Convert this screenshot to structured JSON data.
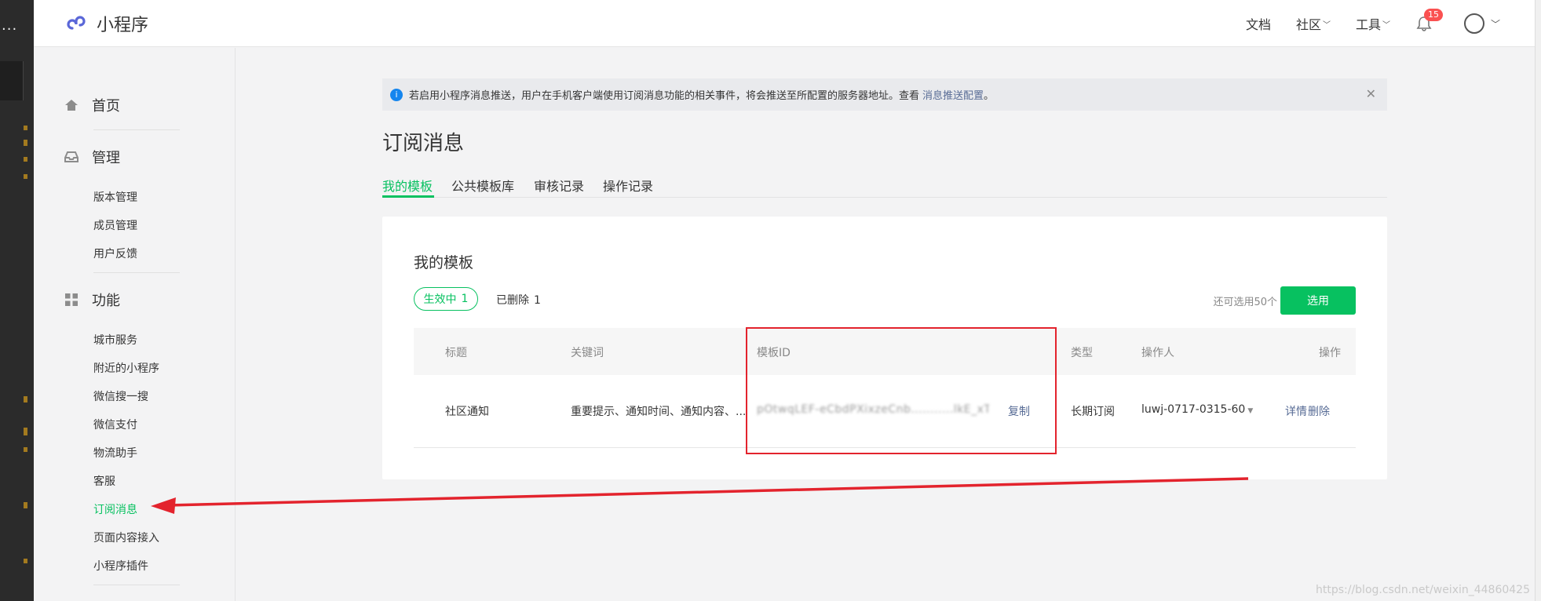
{
  "brand": {
    "name": "小程序"
  },
  "topnav": {
    "docs": "文档",
    "community": "社区",
    "tools": "工具",
    "notifications_count": "15"
  },
  "left_strip": {
    "ellipsis": "..."
  },
  "sidebar": {
    "sections": [
      {
        "label": "首页",
        "icon": "home-icon"
      },
      {
        "label": "管理",
        "icon": "inbox-icon",
        "items": [
          "版本管理",
          "成员管理",
          "用户反馈"
        ]
      },
      {
        "label": "功能",
        "icon": "grid-icon",
        "items": [
          "城市服务",
          "附近的小程序",
          "微信搜一搜",
          "微信支付",
          "物流助手",
          "客服",
          "订阅消息",
          "页面内容接入",
          "小程序插件"
        ]
      }
    ],
    "active_item": "订阅消息"
  },
  "notice": {
    "text": "若启用小程序消息推送，用户在手机客户端使用订阅消息功能的相关事件，将会推送至所配置的服务器地址。查看",
    "link": "消息推送配置",
    "tail": "。"
  },
  "page_title": "订阅消息",
  "tabs": [
    "我的模板",
    "公共模板库",
    "审核记录",
    "操作记录"
  ],
  "panel": {
    "title": "我的模板",
    "active_pill": {
      "label": "生效中",
      "count": "1"
    },
    "deleted": {
      "label": "已删除",
      "count": "1"
    },
    "remaining": "还可选用50个",
    "select_button": "选用"
  },
  "table": {
    "headers": [
      "标题",
      "关键词",
      "模板ID",
      "类型",
      "操作人",
      "操作"
    ],
    "rows": [
      {
        "title": "社区通知",
        "keywords": "重要提示、通知时间、通知内容、...",
        "template_id": "pOtwqLEF-eCbdPXixzeCnb...........lkE_xTlhPFE...",
        "copy": "复制",
        "type": "长期订阅",
        "operator": "luwj-0717-0315-60",
        "detail": "详情",
        "delete": "删除"
      }
    ]
  },
  "watermark": "https://blog.csdn.net/weixin_44860425",
  "colors": {
    "accent": "#07c160",
    "link": "#576b95",
    "annotation": "#e3232d"
  }
}
